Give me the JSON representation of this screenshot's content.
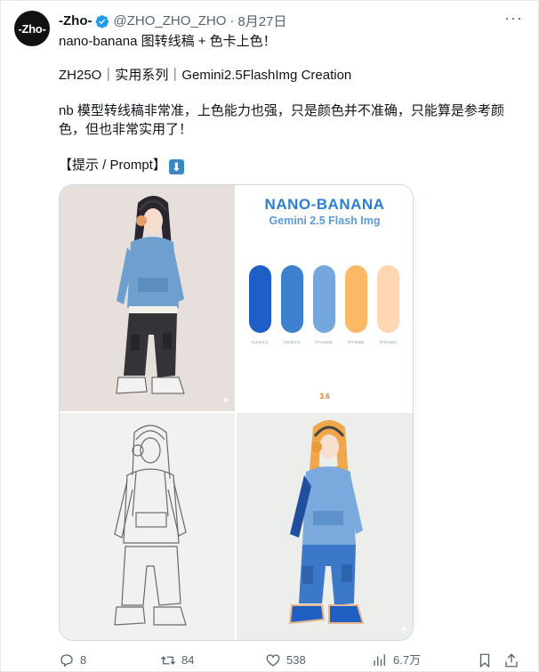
{
  "author": {
    "avatar_text": "-Zho-",
    "display_name": "-Zho-",
    "handle": "@ZHO_ZHO_ZHO",
    "separator": "·",
    "date": "8月27日"
  },
  "tweet": {
    "line1": "nano-banana 图转线稿 + 色卡上色！",
    "line2": "ZH25O｜实用系列｜Gemini2.5FlashImg Creation",
    "line3": "nb 模型转线稿非常准，上色能力也强，只是颜色并不准确，只能算是参考颜色，但也非常实用了！",
    "line4": "【提示 / Prompt】"
  },
  "media": {
    "palette": {
      "title": "NANO-BANANA",
      "subtitle": "Gemini 2.5 Flash Img",
      "swatches": [
        {
          "color": "#1e5ec7",
          "hex": "#1E60C3"
        },
        {
          "color": "#3d80cf",
          "hex": "#3D80C5"
        },
        {
          "color": "#74a8dd",
          "hex": "#74A8DB"
        },
        {
          "color": "#ffb866",
          "hex": "#FFB86B"
        },
        {
          "color": "#ffd6b4",
          "hex": "#FFD6B3"
        }
      ],
      "badge": "3.6"
    }
  },
  "actions": {
    "replies": "8",
    "retweets": "84",
    "likes": "538",
    "views": "6.7万"
  },
  "colors": {
    "accent": "#1d9bf0",
    "secondary_text": "#536471"
  }
}
